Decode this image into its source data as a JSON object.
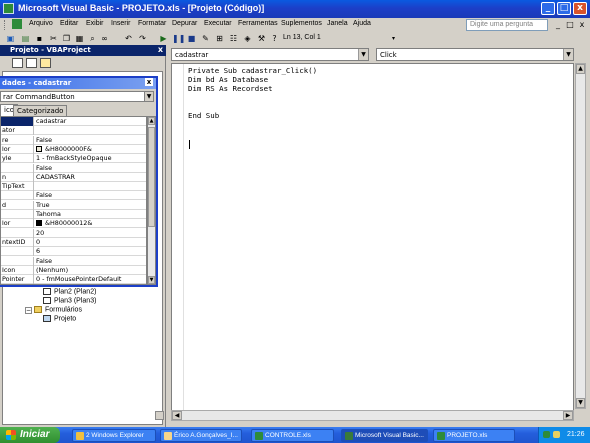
{
  "window": {
    "title": "Microsoft Visual Basic - PROJETO.xls - [Projeto (Código)]",
    "controls": [
      "_",
      "□",
      "x"
    ]
  },
  "menu": {
    "items": [
      "Arquivo",
      "Editar",
      "Exibir",
      "Inserir",
      "Formatar",
      "Depurar",
      "Executar",
      "Ferramentas",
      "Suplementos",
      "Janela",
      "Ajuda"
    ],
    "help_placeholder": "Digite uma pergunta",
    "mdi_controls": [
      "_",
      "□",
      "x"
    ]
  },
  "toolbar": {
    "position_label": "Ln 13, Col 1"
  },
  "project_explorer": {
    "title": "Projeto - VBAProject",
    "close": "x",
    "tree": [
      {
        "label": "Plan2 (Plan2)",
        "icon": "sheet-icon"
      },
      {
        "label": "Plan3 (Plan3)",
        "icon": "sheet-icon"
      },
      {
        "label": "Formulários",
        "icon": "folder-icon"
      },
      {
        "label": "Projeto",
        "icon": "form-icon"
      }
    ]
  },
  "properties": {
    "title": "dades - cadastrar",
    "close": "x",
    "object": "rar CommandButton",
    "tabs": [
      "ico",
      "Categorizado"
    ],
    "rows": [
      {
        "name": "",
        "value": "cadastrar"
      },
      {
        "name": "ator",
        "value": ""
      },
      {
        "name": "re",
        "value": "False"
      },
      {
        "name": "lor",
        "value": "&H8000000F&",
        "swatch": "#ece9d8"
      },
      {
        "name": "yle",
        "value": "1 - fmBackStyleOpaque"
      },
      {
        "name": "",
        "value": "False"
      },
      {
        "name": "n",
        "value": "CADASTRAR"
      },
      {
        "name": "TipText",
        "value": ""
      },
      {
        "name": "",
        "value": "False"
      },
      {
        "name": "d",
        "value": "True"
      },
      {
        "name": "",
        "value": "Tahoma"
      },
      {
        "name": "lor",
        "value": "&H80000012&",
        "swatch": "#000000"
      },
      {
        "name": "",
        "value": "20"
      },
      {
        "name": "ntextID",
        "value": "0"
      },
      {
        "name": "",
        "value": "6"
      },
      {
        "name": "",
        "value": "False"
      },
      {
        "name": "Icon",
        "value": "(Nenhum)"
      },
      {
        "name": "Pointer",
        "value": "0 - fmMousePointerDefault"
      }
    ]
  },
  "code_window": {
    "object_combo": "cadastrar",
    "procedure_combo": "Click",
    "lines": [
      "Private Sub cadastrar_Click()",
      "Dim bd As Database",
      "Dim RS As Recordset",
      "",
      "",
      "End Sub"
    ]
  },
  "taskbar": {
    "start_label": "Iniciar",
    "tasks": [
      {
        "label": "2 Windows Explorer",
        "color": "#f0c040"
      },
      {
        "label": "Érico A.Gonçalves_I...",
        "color": "#f5d58a"
      },
      {
        "label": "CONTROLE.xls",
        "color": "#2e8b3a"
      },
      {
        "label": "Microsoft Visual Basic...",
        "color": "#3a7a3a",
        "active": true
      },
      {
        "label": "PROJETO.xls",
        "color": "#2e8b3a"
      }
    ],
    "clock": "21:26"
  },
  "colors": {
    "titlebar": "#1c3fc8",
    "taskbar": "#245edc",
    "start": "#2f8f2f",
    "selection": "#0a246a"
  }
}
